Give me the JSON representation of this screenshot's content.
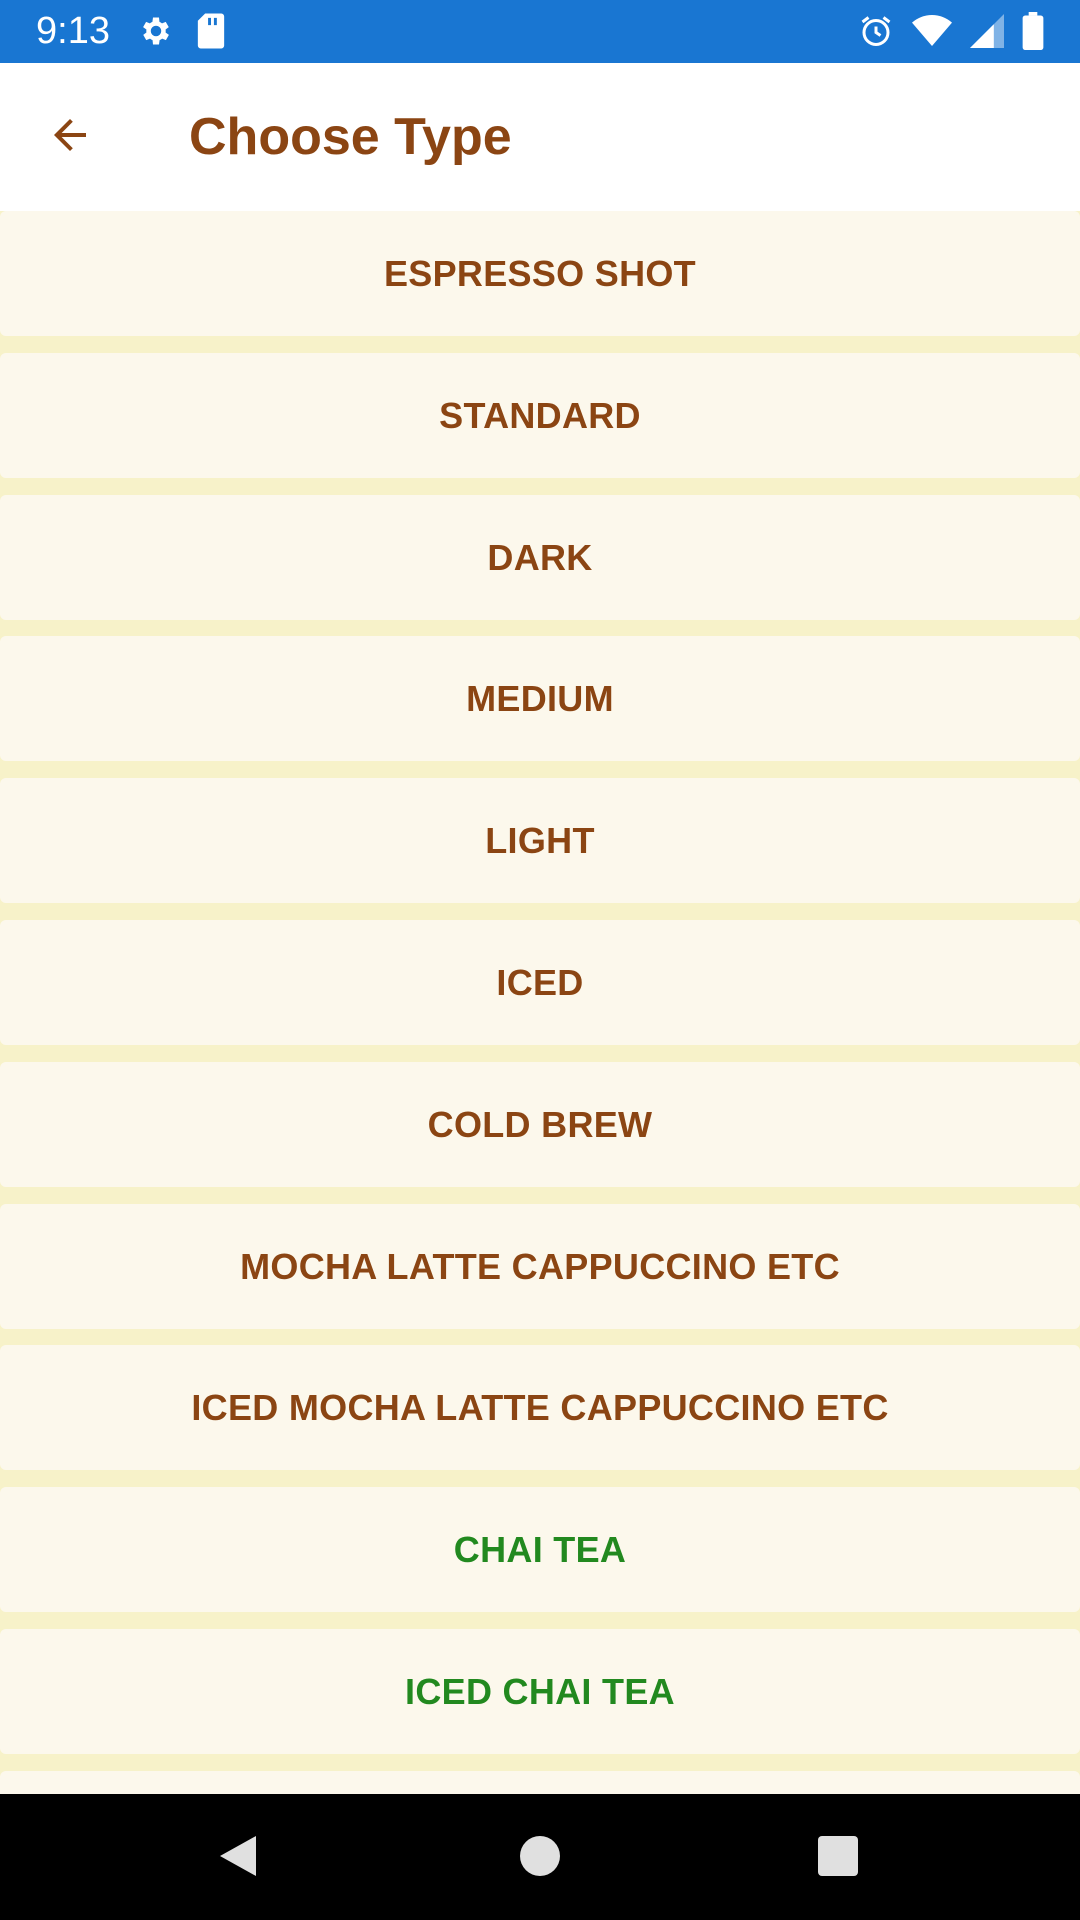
{
  "status_bar": {
    "time": "9:13",
    "left_icons": [
      "gear-icon",
      "sd-card-icon"
    ],
    "right_icons": [
      "alarm-icon",
      "wifi-icon",
      "signal-icon",
      "battery-icon"
    ],
    "color": "#1976d2"
  },
  "app_bar": {
    "title": "Choose Type",
    "back_icon": "arrow-back-icon",
    "accent_color": "#8b4513"
  },
  "list": {
    "items": [
      {
        "label": "ESPRESSO SHOT",
        "category": "coffee"
      },
      {
        "label": "STANDARD",
        "category": "coffee"
      },
      {
        "label": "DARK",
        "category": "coffee"
      },
      {
        "label": "MEDIUM",
        "category": "coffee"
      },
      {
        "label": "LIGHT",
        "category": "coffee"
      },
      {
        "label": "ICED",
        "category": "coffee"
      },
      {
        "label": "COLD BREW",
        "category": "coffee"
      },
      {
        "label": "MOCHA LATTE CAPPUCCINO ETC",
        "category": "coffee"
      },
      {
        "label": "ICED MOCHA LATTE CAPPUCCINO ETC",
        "category": "coffee"
      },
      {
        "label": "CHAI TEA",
        "category": "tea"
      },
      {
        "label": "ICED CHAI TEA",
        "category": "tea"
      }
    ],
    "coffee_text_color": "#8b4513",
    "tea_text_color": "#22891f",
    "row_background": "#fcf8ec",
    "list_background": "#f7f2c9"
  },
  "nav_bar": {
    "buttons": [
      "back-triangle-icon",
      "home-circle-icon",
      "recents-square-icon"
    ]
  }
}
